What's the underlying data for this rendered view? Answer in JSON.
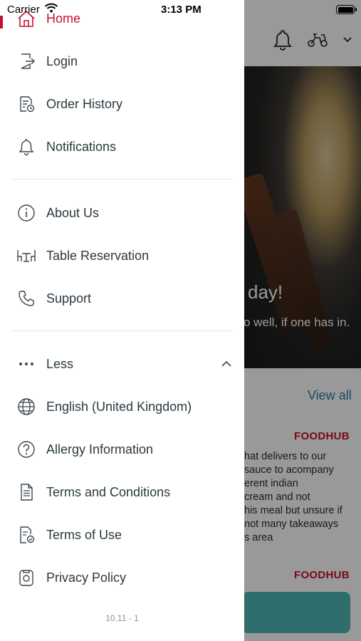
{
  "status_bar": {
    "carrier": "Carrier",
    "time": "3:13 PM"
  },
  "background": {
    "hero_title": "day!",
    "hero_subtitle": "o well, if one has in.",
    "view_all": "View all",
    "logo_text": "FOODHUB",
    "review_lines": [
      "hat delivers to our",
      "sauce to acompany",
      "erent indian",
      "cream and not",
      "his meal but unsure if",
      "not many takeaways",
      "s area"
    ]
  },
  "drawer": {
    "items_top": [
      {
        "label": "Home",
        "icon": "home-icon"
      },
      {
        "label": "Login",
        "icon": "login-icon"
      },
      {
        "label": "Order History",
        "icon": "order-history-icon"
      },
      {
        "label": "Notifications",
        "icon": "bell-icon"
      }
    ],
    "items_middle": [
      {
        "label": "About Us",
        "icon": "info-icon"
      },
      {
        "label": "Table Reservation",
        "icon": "table-icon"
      },
      {
        "label": "Support",
        "icon": "phone-icon"
      }
    ],
    "less": {
      "label": "Less",
      "icon": "more-dots-icon"
    },
    "items_bottom": [
      {
        "label": "English (United Kingdom)",
        "icon": "globe-icon"
      },
      {
        "label": "Allergy Information",
        "icon": "question-icon"
      },
      {
        "label": "Terms and Conditions",
        "icon": "document-icon"
      },
      {
        "label": "Terms of Use",
        "icon": "document-check-icon"
      },
      {
        "label": "Privacy Policy",
        "icon": "privacy-icon"
      }
    ],
    "version": "10.11 - 1"
  },
  "colors": {
    "accent": "#c8102e",
    "link": "#2a7fa6",
    "teal": "#4fb8b4"
  }
}
